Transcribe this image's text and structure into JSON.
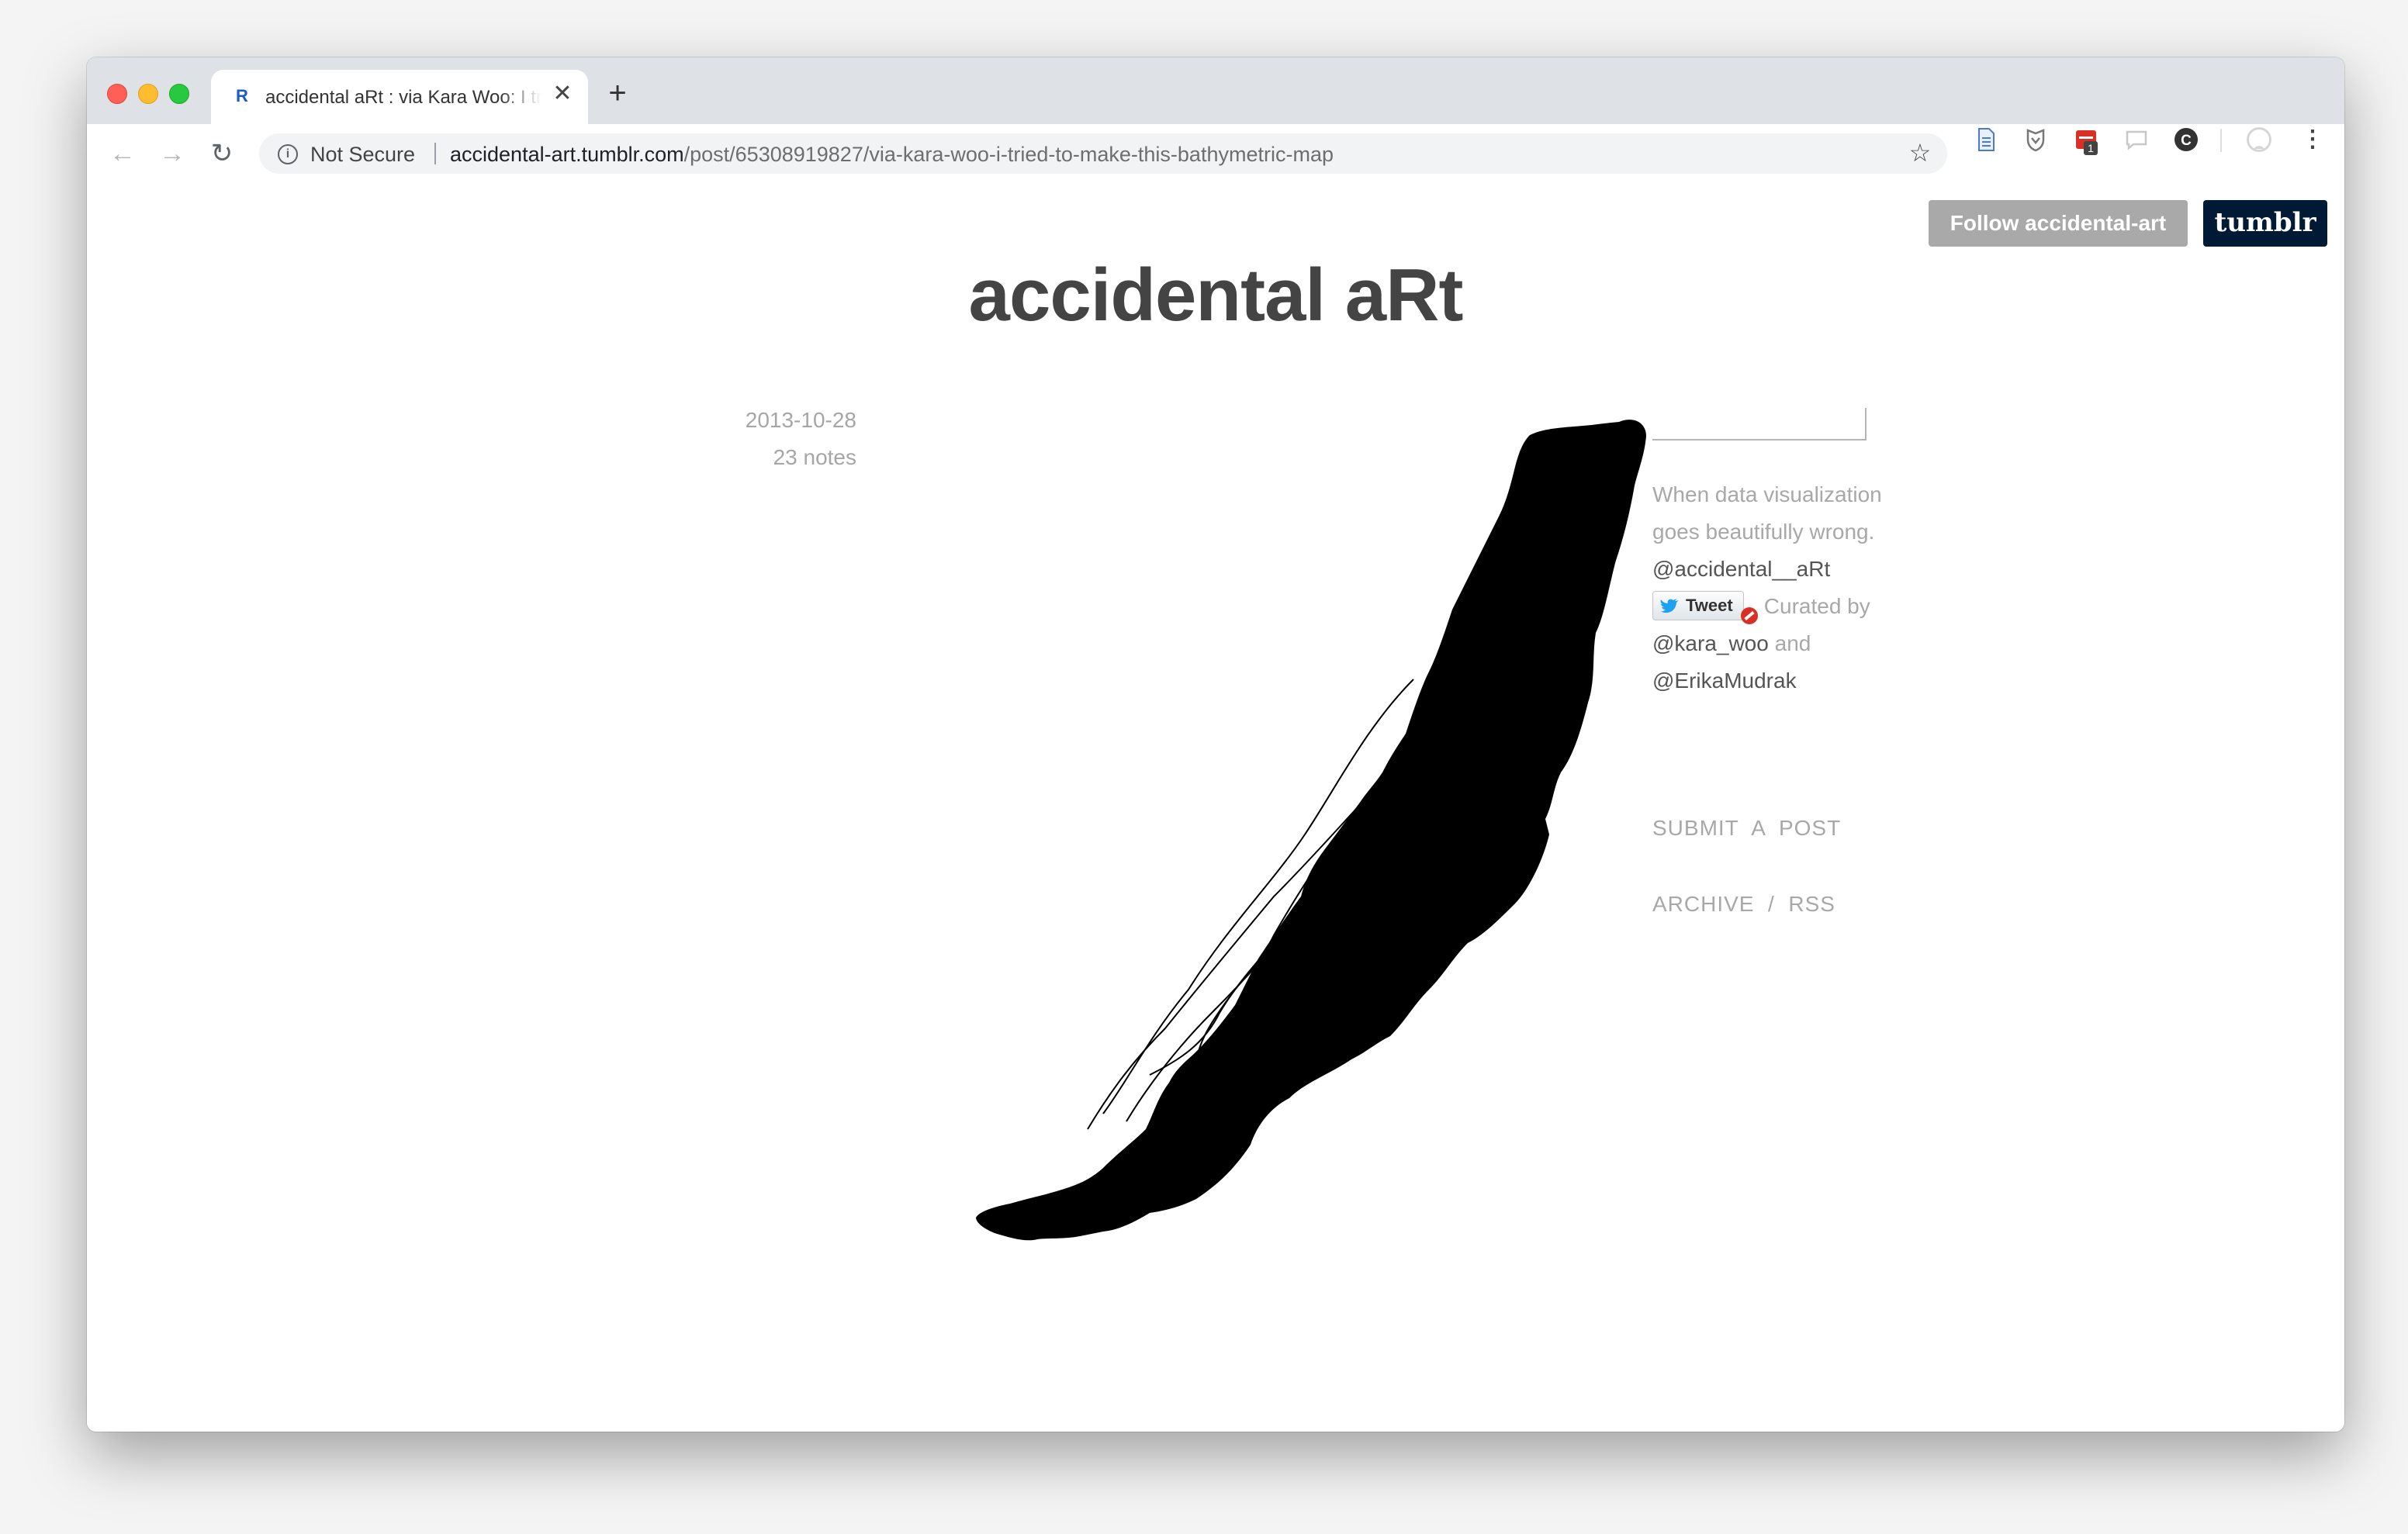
{
  "browser": {
    "tab_title": "accidental aRt : via Kara Woo: I tried to make this bathymetric map",
    "tab_favicon": "R",
    "tab_close": "✕",
    "new_tab": "+",
    "back": "←",
    "forward": "→",
    "reload": "↻",
    "security_label": "Not Secure",
    "url_host": "accidental-art.tumblr.com",
    "url_path": "/post/65308919827/via-kara-woo-i-tried-to-make-this-bathymetric-map",
    "bookmark": "☆",
    "extension_badge": "1",
    "menu": "⋮",
    "extension_icons": [
      "document-icon",
      "shield-icon",
      "calendar-icon",
      "chat-icon",
      "c-circle-icon",
      "profile-icon"
    ]
  },
  "page": {
    "follow_label": "Follow accidental-art",
    "tumblr_label": "tumblr",
    "blog_title": "accidental aRt",
    "post": {
      "date": "2013-10-28",
      "notes": "23 notes",
      "image": "bathymetric-map-image"
    },
    "sidebar": {
      "search_placeholder": "",
      "description": "When data visualization goes beautifully wrong.",
      "twitter_handle": "@accidental__aRt",
      "tweet_label": "Tweet",
      "curated_by": "Curated by",
      "curator1": "@kara_woo",
      "and": "and",
      "curator2": "@ErikaMudrak",
      "submit": "SUBMIT  A  POST",
      "archive": "ARCHIVE",
      "nav_sep": "/",
      "rss": "RSS"
    }
  },
  "colors": {
    "tabstrip": "#dee1e6",
    "follow_button": "#a9a9a9",
    "tumblr_button": "#001935",
    "title_text": "#444444",
    "muted_text": "#a8a8a8"
  }
}
